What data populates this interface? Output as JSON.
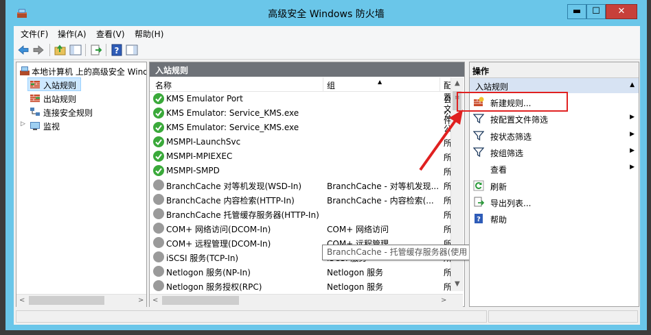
{
  "window": {
    "title": "高级安全 Windows 防火墙",
    "controls": {
      "minimize": "▬",
      "maximize": "☐",
      "close": "✕"
    }
  },
  "menubar": {
    "items": [
      {
        "label": "文件(F)"
      },
      {
        "label": "操作(A)"
      },
      {
        "label": "查看(V)"
      },
      {
        "label": "帮助(H)"
      }
    ]
  },
  "tree": {
    "root_label": "本地计算机 上的高级安全 Windows 防火墙",
    "items": [
      {
        "label": "入站规则",
        "selected": true
      },
      {
        "label": "出站规则"
      },
      {
        "label": "连接安全规则"
      },
      {
        "label": "监视"
      }
    ]
  },
  "center": {
    "header": "入站规则",
    "columns": {
      "name": "名称",
      "group": "组",
      "profile": "配置文件"
    },
    "rows": [
      {
        "name": "KMS Emulator Port",
        "group": "",
        "profile": "公用",
        "enabled": true
      },
      {
        "name": "KMS Emulator: Service_KMS.exe",
        "group": "",
        "profile": "公用",
        "enabled": true
      },
      {
        "name": "KMS Emulator: Service_KMS.exe",
        "group": "",
        "profile": "公用",
        "enabled": true
      },
      {
        "name": "MSMPI-LaunchSvc",
        "group": "",
        "profile": "所有",
        "enabled": true
      },
      {
        "name": "MSMPI-MPIEXEC",
        "group": "",
        "profile": "所有",
        "enabled": true
      },
      {
        "name": "MSMPI-SMPD",
        "group": "",
        "profile": "所有",
        "enabled": true
      },
      {
        "name": "BranchCache 对等机发现(WSD-In)",
        "group": "BranchCache - 对等机发现...",
        "profile": "所有",
        "enabled": false
      },
      {
        "name": "BranchCache 内容检索(HTTP-In)",
        "group": "BranchCache - 内容检索(...",
        "profile": "所有",
        "enabled": false
      },
      {
        "name": "BranchCache 托管缓存服务器(HTTP-In)",
        "group": "",
        "profile": "所有",
        "enabled": false
      },
      {
        "name": "COM+ 网络访问(DCOM-In)",
        "group": "COM+ 网络访问",
        "profile": "所有",
        "enabled": false
      },
      {
        "name": "COM+ 远程管理(DCOM-In)",
        "group": "COM+ 远程管理",
        "profile": "所有",
        "enabled": false
      },
      {
        "name": "iSCSI 服务(TCP-In)",
        "group": "iSCSI 服务",
        "profile": "所有",
        "enabled": false
      },
      {
        "name": "Netlogon 服务(NP-In)",
        "group": "Netlogon 服务",
        "profile": "所有",
        "enabled": false
      },
      {
        "name": "Netlogon 服务授权(RPC)",
        "group": "Netlogon 服务",
        "profile": "所有",
        "enabled": false
      }
    ],
    "tooltip": "BranchCache - 托管缓存服务器(使用 HTTPS)"
  },
  "actions": {
    "title": "操作",
    "section": "入站规则",
    "items": [
      {
        "label": "新建规则...",
        "icon": "new-rule-icon",
        "submenu": false
      },
      {
        "label": "按配置文件筛选",
        "icon": "filter-icon",
        "submenu": true
      },
      {
        "label": "按状态筛选",
        "icon": "filter-icon",
        "submenu": true
      },
      {
        "label": "按组筛选",
        "icon": "filter-icon",
        "submenu": true
      },
      {
        "label": "查看",
        "icon": "",
        "submenu": true
      },
      {
        "label": "刷新",
        "icon": "refresh-icon",
        "submenu": false
      },
      {
        "label": "导出列表...",
        "icon": "export-icon",
        "submenu": false
      },
      {
        "label": "帮助",
        "icon": "help-icon",
        "submenu": false
      }
    ]
  },
  "colors": {
    "title_bar": "#6ac6e9",
    "pane_header": "#6e7278",
    "enabled_green": "#3aa93a",
    "disabled_gray": "#9a9a9a",
    "annotation_red": "#e02020"
  }
}
